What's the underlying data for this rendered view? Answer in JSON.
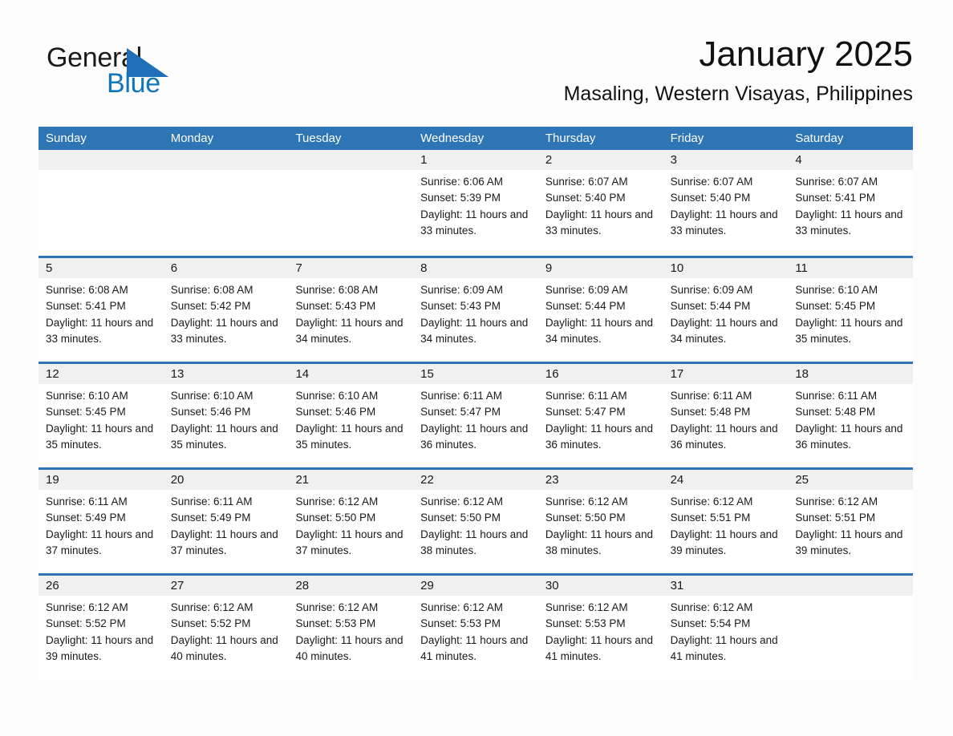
{
  "brand": {
    "name_part1": "General",
    "name_part2": "Blue",
    "triangle_color": "#1f6fb8",
    "text_color_part1": "#1a1a1a",
    "text_color_part2": "#0f76bc"
  },
  "header": {
    "title": "January 2025",
    "subtitle": "Masaling, Western Visayas, Philippines"
  },
  "theme": {
    "header_blue": "#2e75b6",
    "row_divider_blue": "#2e75b6",
    "day_band_gray": "#f0f0f0",
    "page_background": "#fdfdfd"
  },
  "weekdays": [
    "Sunday",
    "Monday",
    "Tuesday",
    "Wednesday",
    "Thursday",
    "Friday",
    "Saturday"
  ],
  "weeks": [
    [
      {
        "day": "",
        "sunrise": "",
        "sunset": "",
        "daylight": ""
      },
      {
        "day": "",
        "sunrise": "",
        "sunset": "",
        "daylight": ""
      },
      {
        "day": "",
        "sunrise": "",
        "sunset": "",
        "daylight": ""
      },
      {
        "day": "1",
        "sunrise": "Sunrise: 6:06 AM",
        "sunset": "Sunset: 5:39 PM",
        "daylight": "Daylight: 11 hours and 33 minutes."
      },
      {
        "day": "2",
        "sunrise": "Sunrise: 6:07 AM",
        "sunset": "Sunset: 5:40 PM",
        "daylight": "Daylight: 11 hours and 33 minutes."
      },
      {
        "day": "3",
        "sunrise": "Sunrise: 6:07 AM",
        "sunset": "Sunset: 5:40 PM",
        "daylight": "Daylight: 11 hours and 33 minutes."
      },
      {
        "day": "4",
        "sunrise": "Sunrise: 6:07 AM",
        "sunset": "Sunset: 5:41 PM",
        "daylight": "Daylight: 11 hours and 33 minutes."
      }
    ],
    [
      {
        "day": "5",
        "sunrise": "Sunrise: 6:08 AM",
        "sunset": "Sunset: 5:41 PM",
        "daylight": "Daylight: 11 hours and 33 minutes."
      },
      {
        "day": "6",
        "sunrise": "Sunrise: 6:08 AM",
        "sunset": "Sunset: 5:42 PM",
        "daylight": "Daylight: 11 hours and 33 minutes."
      },
      {
        "day": "7",
        "sunrise": "Sunrise: 6:08 AM",
        "sunset": "Sunset: 5:43 PM",
        "daylight": "Daylight: 11 hours and 34 minutes."
      },
      {
        "day": "8",
        "sunrise": "Sunrise: 6:09 AM",
        "sunset": "Sunset: 5:43 PM",
        "daylight": "Daylight: 11 hours and 34 minutes."
      },
      {
        "day": "9",
        "sunrise": "Sunrise: 6:09 AM",
        "sunset": "Sunset: 5:44 PM",
        "daylight": "Daylight: 11 hours and 34 minutes."
      },
      {
        "day": "10",
        "sunrise": "Sunrise: 6:09 AM",
        "sunset": "Sunset: 5:44 PM",
        "daylight": "Daylight: 11 hours and 34 minutes."
      },
      {
        "day": "11",
        "sunrise": "Sunrise: 6:10 AM",
        "sunset": "Sunset: 5:45 PM",
        "daylight": "Daylight: 11 hours and 35 minutes."
      }
    ],
    [
      {
        "day": "12",
        "sunrise": "Sunrise: 6:10 AM",
        "sunset": "Sunset: 5:45 PM",
        "daylight": "Daylight: 11 hours and 35 minutes."
      },
      {
        "day": "13",
        "sunrise": "Sunrise: 6:10 AM",
        "sunset": "Sunset: 5:46 PM",
        "daylight": "Daylight: 11 hours and 35 minutes."
      },
      {
        "day": "14",
        "sunrise": "Sunrise: 6:10 AM",
        "sunset": "Sunset: 5:46 PM",
        "daylight": "Daylight: 11 hours and 35 minutes."
      },
      {
        "day": "15",
        "sunrise": "Sunrise: 6:11 AM",
        "sunset": "Sunset: 5:47 PM",
        "daylight": "Daylight: 11 hours and 36 minutes."
      },
      {
        "day": "16",
        "sunrise": "Sunrise: 6:11 AM",
        "sunset": "Sunset: 5:47 PM",
        "daylight": "Daylight: 11 hours and 36 minutes."
      },
      {
        "day": "17",
        "sunrise": "Sunrise: 6:11 AM",
        "sunset": "Sunset: 5:48 PM",
        "daylight": "Daylight: 11 hours and 36 minutes."
      },
      {
        "day": "18",
        "sunrise": "Sunrise: 6:11 AM",
        "sunset": "Sunset: 5:48 PM",
        "daylight": "Daylight: 11 hours and 36 minutes."
      }
    ],
    [
      {
        "day": "19",
        "sunrise": "Sunrise: 6:11 AM",
        "sunset": "Sunset: 5:49 PM",
        "daylight": "Daylight: 11 hours and 37 minutes."
      },
      {
        "day": "20",
        "sunrise": "Sunrise: 6:11 AM",
        "sunset": "Sunset: 5:49 PM",
        "daylight": "Daylight: 11 hours and 37 minutes."
      },
      {
        "day": "21",
        "sunrise": "Sunrise: 6:12 AM",
        "sunset": "Sunset: 5:50 PM",
        "daylight": "Daylight: 11 hours and 37 minutes."
      },
      {
        "day": "22",
        "sunrise": "Sunrise: 6:12 AM",
        "sunset": "Sunset: 5:50 PM",
        "daylight": "Daylight: 11 hours and 38 minutes."
      },
      {
        "day": "23",
        "sunrise": "Sunrise: 6:12 AM",
        "sunset": "Sunset: 5:50 PM",
        "daylight": "Daylight: 11 hours and 38 minutes."
      },
      {
        "day": "24",
        "sunrise": "Sunrise: 6:12 AM",
        "sunset": "Sunset: 5:51 PM",
        "daylight": "Daylight: 11 hours and 39 minutes."
      },
      {
        "day": "25",
        "sunrise": "Sunrise: 6:12 AM",
        "sunset": "Sunset: 5:51 PM",
        "daylight": "Daylight: 11 hours and 39 minutes."
      }
    ],
    [
      {
        "day": "26",
        "sunrise": "Sunrise: 6:12 AM",
        "sunset": "Sunset: 5:52 PM",
        "daylight": "Daylight: 11 hours and 39 minutes."
      },
      {
        "day": "27",
        "sunrise": "Sunrise: 6:12 AM",
        "sunset": "Sunset: 5:52 PM",
        "daylight": "Daylight: 11 hours and 40 minutes."
      },
      {
        "day": "28",
        "sunrise": "Sunrise: 6:12 AM",
        "sunset": "Sunset: 5:53 PM",
        "daylight": "Daylight: 11 hours and 40 minutes."
      },
      {
        "day": "29",
        "sunrise": "Sunrise: 6:12 AM",
        "sunset": "Sunset: 5:53 PM",
        "daylight": "Daylight: 11 hours and 41 minutes."
      },
      {
        "day": "30",
        "sunrise": "Sunrise: 6:12 AM",
        "sunset": "Sunset: 5:53 PM",
        "daylight": "Daylight: 11 hours and 41 minutes."
      },
      {
        "day": "31",
        "sunrise": "Sunrise: 6:12 AM",
        "sunset": "Sunset: 5:54 PM",
        "daylight": "Daylight: 11 hours and 41 minutes."
      },
      {
        "day": "",
        "sunrise": "",
        "sunset": "",
        "daylight": ""
      }
    ]
  ]
}
